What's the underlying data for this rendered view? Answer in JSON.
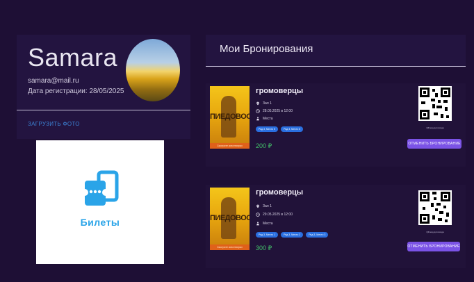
{
  "profile": {
    "name": "Samara",
    "email": "samara@mail.ru",
    "registration": "Дата регистрации: 28/05/2025",
    "upload_label": "ЗАГРУЗИТЬ ФОТО"
  },
  "logo": {
    "text": "Билеты"
  },
  "bookings": {
    "title": "Мои Бронирования",
    "items": [
      {
        "poster_title": "ПИЕДОВОО",
        "poster_caption": "Смотрите кинотеатрах",
        "movie": "громоверцы",
        "hall": "Зал 1",
        "datetime": "28.05.2025 в 12:00",
        "seats_label": "Места",
        "seats": [
          "Ряд 3, Место 5",
          "Ряд 3, Место 6"
        ],
        "price": "200 ₽",
        "qr_caption": "QR-код для входа",
        "cancel_label": "ОТМЕНИТЬ БРОНИРОВАНИЕ"
      },
      {
        "poster_title": "ПИЕДОВОО",
        "poster_caption": "Смотрите кинотеатрах",
        "movie": "громоверцы",
        "hall": "Зал 1",
        "datetime": "29.05.2025 в 12:00",
        "seats_label": "Места",
        "seats": [
          "Ряд 3, Место 1",
          "Ряд 3, Место 2",
          "Ряд 3, Место 3"
        ],
        "price": "300 ₽",
        "qr_caption": "QR-код для входа",
        "cancel_label": "ОТМЕНИТЬ БРОНИРОВАНИЕ"
      }
    ]
  },
  "colors": {
    "background": "#1e0f35",
    "accent": "#7b53e6",
    "price": "#43c46a",
    "link": "#3c82d4",
    "chip": "#2a6fe0"
  }
}
